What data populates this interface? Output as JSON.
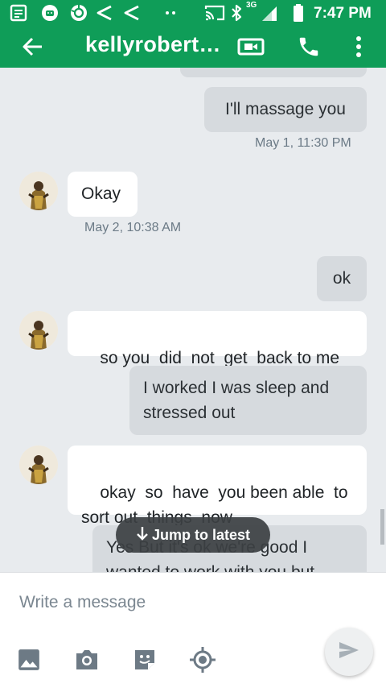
{
  "status_bar": {
    "time": "7:47 PM",
    "network_label": "3G"
  },
  "app_bar": {
    "title": "kellyrobert…"
  },
  "messages": [
    {
      "id": "m1",
      "text": "I'll massage you",
      "direction": "sent",
      "timestamp": "May 1, 11:30 PM"
    },
    {
      "id": "m2",
      "text": "Okay",
      "direction": "received",
      "timestamp": "May 2, 10:38 AM"
    },
    {
      "id": "m3",
      "text": "ok",
      "direction": "sent"
    },
    {
      "id": "m4",
      "text": "so you  did  not  get  back to me",
      "direction": "received"
    },
    {
      "id": "m5",
      "text": "I worked I was sleep and stressed out",
      "direction": "sent"
    },
    {
      "id": "m6",
      "text": "okay  so  have  you been able  to sort out  things  now",
      "direction": "received"
    },
    {
      "id": "m7",
      "text": "Yes But it's ok we're good I wanted to work with you but",
      "direction": "sent"
    }
  ],
  "jump_button": {
    "label": "Jump to latest"
  },
  "composer": {
    "placeholder": "Write a message"
  },
  "colors": {
    "app_bar": "#0f9d58",
    "sent_bubble": "#d6dade",
    "received_bubble": "#ffffff",
    "background": "#e8ebee"
  }
}
